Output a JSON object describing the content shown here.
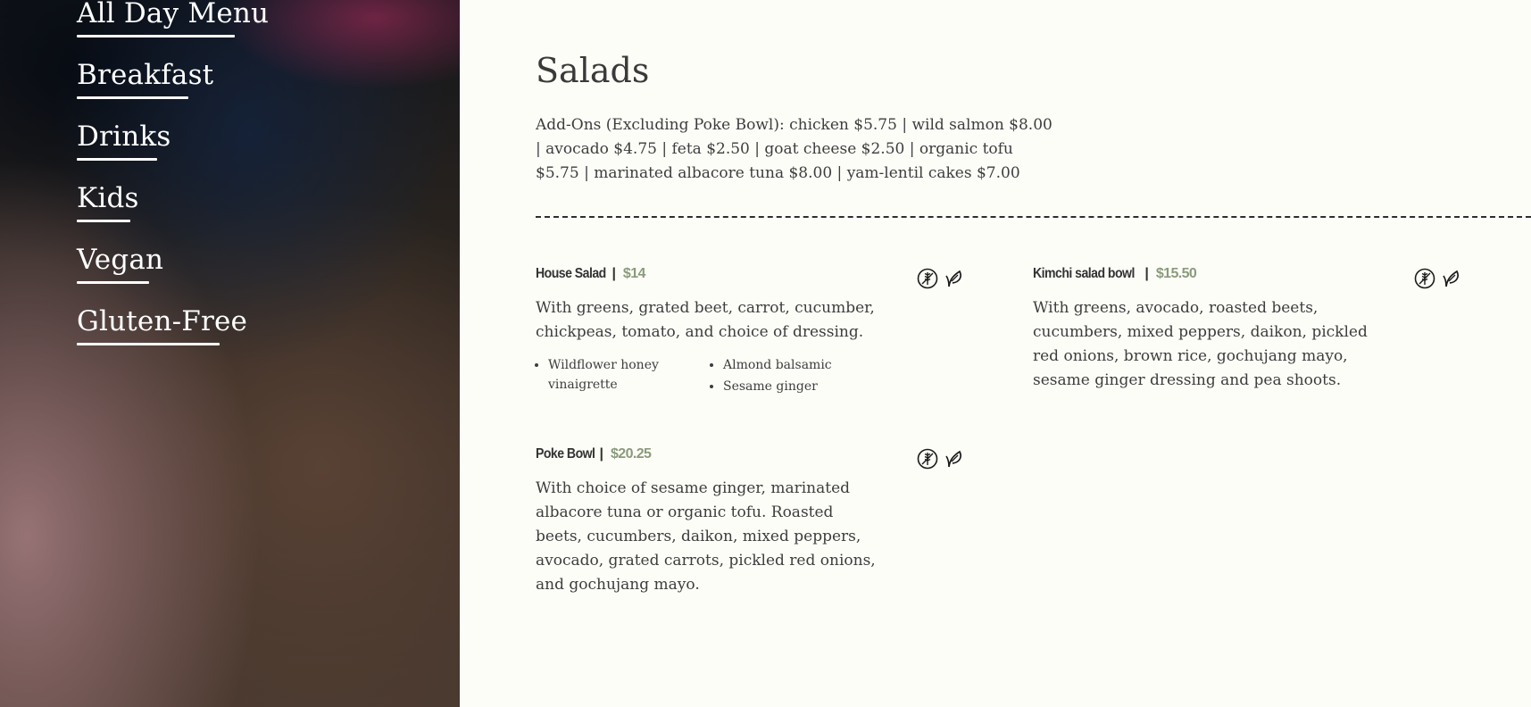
{
  "nav": {
    "items": [
      {
        "label": "All Day Menu"
      },
      {
        "label": "Breakfast"
      },
      {
        "label": "Drinks"
      },
      {
        "label": "Kids"
      },
      {
        "label": "Vegan"
      },
      {
        "label": "Gluten-Free"
      }
    ]
  },
  "section": {
    "title": "Salads",
    "addons": "Add-Ons (Excluding Poke Bowl): chicken $5.75 | wild salmon $8.00 | avocado $4.75 | feta $2.50 | goat cheese $2.50 | organic tofu $5.75 | marinated albacore tuna $8.00 | yam-lentil cakes $7.00"
  },
  "items": [
    {
      "name": "House Salad",
      "separator": "|",
      "price": "$14",
      "description": "With greens, grated beet, carrot, cucumber, chickpeas, tomato, and choice of dressing.",
      "dressings_col_a": [
        "Wildflower honey vinaigrette"
      ],
      "dressings_col_b": [
        "Almond balsamic",
        "Sesame ginger"
      ],
      "icons": [
        "gluten-free-icon",
        "vegan-leaf-icon"
      ]
    },
    {
      "name": "Kimchi salad bowl",
      "separator": "|",
      "price": "$15.50",
      "description": "With greens, avocado, roasted beets, cucumbers, mixed peppers, daikon, pickled red onions, brown rice, gochujang mayo, sesame ginger dressing and pea shoots.",
      "icons": [
        "gluten-free-icon",
        "vegan-leaf-icon"
      ]
    },
    {
      "name": "Poke Bowl",
      "separator": "|",
      "price": "$20.25",
      "description": "With choice of sesame ginger, marinated albacore tuna or organic tofu. Roasted beets, cucumbers, daikon, mixed peppers, avocado, grated carrots, pickled red onions, and gochujang mayo.",
      "icons": [
        "gluten-free-icon",
        "vegan-leaf-icon"
      ]
    }
  ],
  "colors": {
    "price": "#8a9a7b",
    "text": "#3d3d3d",
    "background": "#fdfdf8"
  }
}
